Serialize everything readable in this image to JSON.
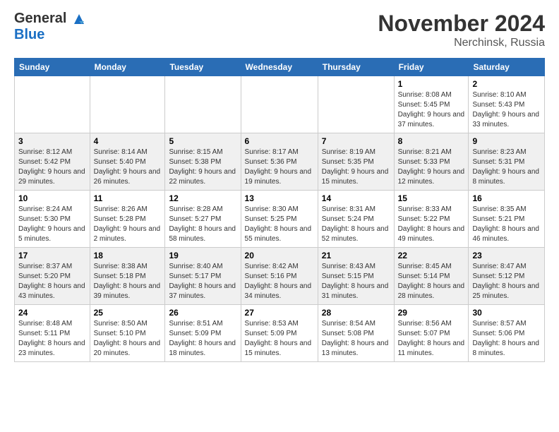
{
  "header": {
    "logo_line1": "General",
    "logo_line2": "Blue",
    "month": "November 2024",
    "location": "Nerchinsk, Russia"
  },
  "weekdays": [
    "Sunday",
    "Monday",
    "Tuesday",
    "Wednesday",
    "Thursday",
    "Friday",
    "Saturday"
  ],
  "weeks": [
    [
      {
        "day": "",
        "info": ""
      },
      {
        "day": "",
        "info": ""
      },
      {
        "day": "",
        "info": ""
      },
      {
        "day": "",
        "info": ""
      },
      {
        "day": "",
        "info": ""
      },
      {
        "day": "1",
        "info": "Sunrise: 8:08 AM\nSunset: 5:45 PM\nDaylight: 9 hours and 37 minutes."
      },
      {
        "day": "2",
        "info": "Sunrise: 8:10 AM\nSunset: 5:43 PM\nDaylight: 9 hours and 33 minutes."
      }
    ],
    [
      {
        "day": "3",
        "info": "Sunrise: 8:12 AM\nSunset: 5:42 PM\nDaylight: 9 hours and 29 minutes."
      },
      {
        "day": "4",
        "info": "Sunrise: 8:14 AM\nSunset: 5:40 PM\nDaylight: 9 hours and 26 minutes."
      },
      {
        "day": "5",
        "info": "Sunrise: 8:15 AM\nSunset: 5:38 PM\nDaylight: 9 hours and 22 minutes."
      },
      {
        "day": "6",
        "info": "Sunrise: 8:17 AM\nSunset: 5:36 PM\nDaylight: 9 hours and 19 minutes."
      },
      {
        "day": "7",
        "info": "Sunrise: 8:19 AM\nSunset: 5:35 PM\nDaylight: 9 hours and 15 minutes."
      },
      {
        "day": "8",
        "info": "Sunrise: 8:21 AM\nSunset: 5:33 PM\nDaylight: 9 hours and 12 minutes."
      },
      {
        "day": "9",
        "info": "Sunrise: 8:23 AM\nSunset: 5:31 PM\nDaylight: 9 hours and 8 minutes."
      }
    ],
    [
      {
        "day": "10",
        "info": "Sunrise: 8:24 AM\nSunset: 5:30 PM\nDaylight: 9 hours and 5 minutes."
      },
      {
        "day": "11",
        "info": "Sunrise: 8:26 AM\nSunset: 5:28 PM\nDaylight: 9 hours and 2 minutes."
      },
      {
        "day": "12",
        "info": "Sunrise: 8:28 AM\nSunset: 5:27 PM\nDaylight: 8 hours and 58 minutes."
      },
      {
        "day": "13",
        "info": "Sunrise: 8:30 AM\nSunset: 5:25 PM\nDaylight: 8 hours and 55 minutes."
      },
      {
        "day": "14",
        "info": "Sunrise: 8:31 AM\nSunset: 5:24 PM\nDaylight: 8 hours and 52 minutes."
      },
      {
        "day": "15",
        "info": "Sunrise: 8:33 AM\nSunset: 5:22 PM\nDaylight: 8 hours and 49 minutes."
      },
      {
        "day": "16",
        "info": "Sunrise: 8:35 AM\nSunset: 5:21 PM\nDaylight: 8 hours and 46 minutes."
      }
    ],
    [
      {
        "day": "17",
        "info": "Sunrise: 8:37 AM\nSunset: 5:20 PM\nDaylight: 8 hours and 43 minutes."
      },
      {
        "day": "18",
        "info": "Sunrise: 8:38 AM\nSunset: 5:18 PM\nDaylight: 8 hours and 39 minutes."
      },
      {
        "day": "19",
        "info": "Sunrise: 8:40 AM\nSunset: 5:17 PM\nDaylight: 8 hours and 37 minutes."
      },
      {
        "day": "20",
        "info": "Sunrise: 8:42 AM\nSunset: 5:16 PM\nDaylight: 8 hours and 34 minutes."
      },
      {
        "day": "21",
        "info": "Sunrise: 8:43 AM\nSunset: 5:15 PM\nDaylight: 8 hours and 31 minutes."
      },
      {
        "day": "22",
        "info": "Sunrise: 8:45 AM\nSunset: 5:14 PM\nDaylight: 8 hours and 28 minutes."
      },
      {
        "day": "23",
        "info": "Sunrise: 8:47 AM\nSunset: 5:12 PM\nDaylight: 8 hours and 25 minutes."
      }
    ],
    [
      {
        "day": "24",
        "info": "Sunrise: 8:48 AM\nSunset: 5:11 PM\nDaylight: 8 hours and 23 minutes."
      },
      {
        "day": "25",
        "info": "Sunrise: 8:50 AM\nSunset: 5:10 PM\nDaylight: 8 hours and 20 minutes."
      },
      {
        "day": "26",
        "info": "Sunrise: 8:51 AM\nSunset: 5:09 PM\nDaylight: 8 hours and 18 minutes."
      },
      {
        "day": "27",
        "info": "Sunrise: 8:53 AM\nSunset: 5:09 PM\nDaylight: 8 hours and 15 minutes."
      },
      {
        "day": "28",
        "info": "Sunrise: 8:54 AM\nSunset: 5:08 PM\nDaylight: 8 hours and 13 minutes."
      },
      {
        "day": "29",
        "info": "Sunrise: 8:56 AM\nSunset: 5:07 PM\nDaylight: 8 hours and 11 minutes."
      },
      {
        "day": "30",
        "info": "Sunrise: 8:57 AM\nSunset: 5:06 PM\nDaylight: 8 hours and 8 minutes."
      }
    ]
  ]
}
